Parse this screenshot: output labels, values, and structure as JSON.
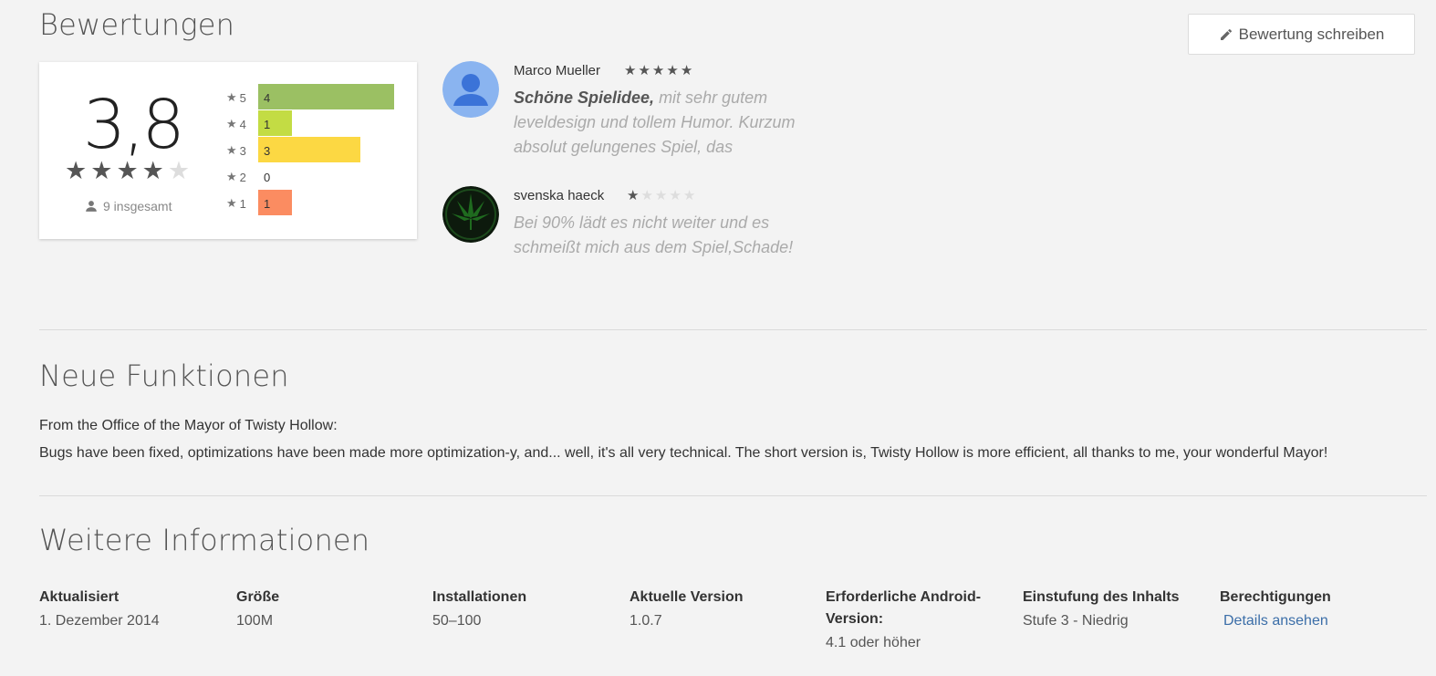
{
  "reviews_section": {
    "title": "Bewertungen",
    "write_button_label": "Bewertung schreiben",
    "summary": {
      "score": "3,8",
      "stars_filled": 4,
      "stars_total": 5,
      "total_text": "9 insgesamt"
    },
    "histogram": [
      {
        "star": "5",
        "count": "4",
        "value": 4,
        "color": "#9bc063"
      },
      {
        "star": "4",
        "count": "1",
        "value": 1,
        "color": "#c3dc44"
      },
      {
        "star": "3",
        "count": "3",
        "value": 3,
        "color": "#fcd843"
      },
      {
        "star": "2",
        "count": "0",
        "value": 0,
        "color": "#fcb448"
      },
      {
        "star": "1",
        "count": "1",
        "value": 1,
        "color": "#fb8c61"
      }
    ],
    "reviews": [
      {
        "author": "Marco Mueller",
        "rating": 5,
        "title": "Schöne Spielidee,",
        "body": "mit sehr gutem leveldesign und tollem Humor. Kurzum absolut gelungenes Spiel, das",
        "avatar": "default-person-avatar"
      },
      {
        "author": "svenska haeck",
        "rating": 1,
        "title": "",
        "body": "Bei 90% lädt es nicht weiter und es schmeißt mich aus dem Spiel,Schade!",
        "avatar": "leaf-avatar"
      }
    ]
  },
  "whats_new": {
    "title": "Neue Funktionen",
    "lines": [
      "From the Office of the Mayor of Twisty Hollow:",
      "Bugs have been fixed, optimizations have been made more optimization-y, and... well, it's all very technical. The short version is, Twisty Hollow is more efficient, all thanks to me, your wonderful Mayor!"
    ]
  },
  "more_info": {
    "title": "Weitere Informationen",
    "items": [
      {
        "label": "Aktualisiert",
        "value": "1. Dezember 2014"
      },
      {
        "label": "Größe",
        "value": "100M"
      },
      {
        "label": "Installationen",
        "value": "50–100"
      },
      {
        "label": "Aktuelle Version",
        "value": "1.0.7"
      },
      {
        "label": "Erforderliche Android-Version:",
        "value": "4.1 oder höher"
      },
      {
        "label": "Einstufung des Inhalts",
        "value": "Stufe 3 - Niedrig"
      },
      {
        "label": "Berechtigungen",
        "link": "Details ansehen"
      }
    ]
  },
  "colors": {
    "star_filled": "#555555",
    "star_empty": "#dddddd",
    "link": "#3b6ea8"
  }
}
